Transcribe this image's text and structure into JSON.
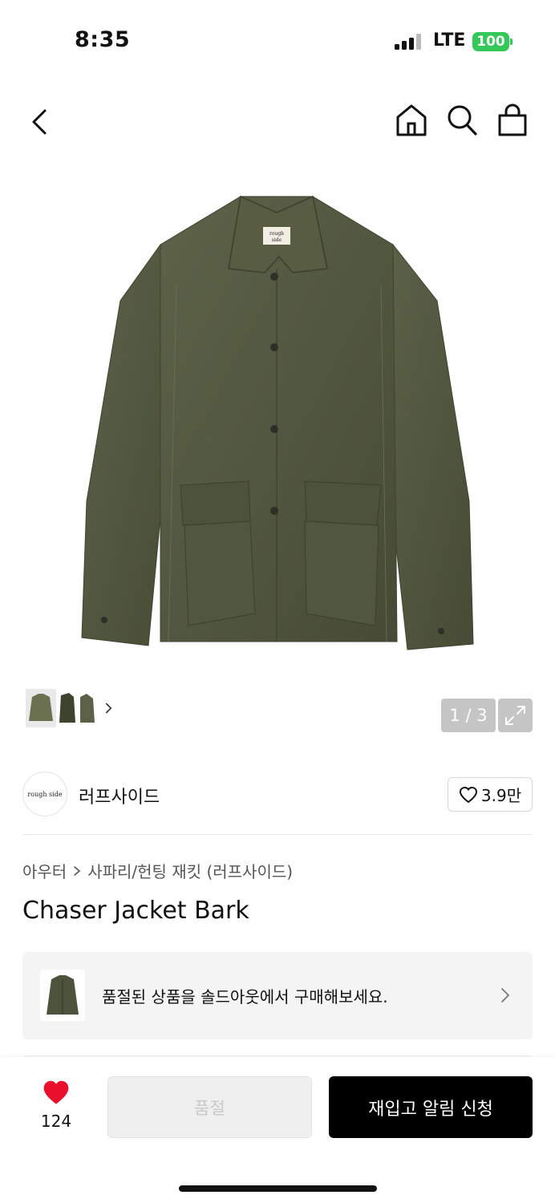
{
  "status_bar": {
    "time": "8:35",
    "network": "LTE",
    "battery": "100",
    "signal_bars_active": 3,
    "signal_bars_total": 4
  },
  "header": {
    "icons": [
      "back-arrow-icon",
      "home-icon",
      "search-icon",
      "shopping-bag-icon"
    ]
  },
  "gallery": {
    "page_indicator": "1 / 3",
    "current_page": 1,
    "total_pages": 3,
    "product_tag_text": "rough side"
  },
  "brand": {
    "logo_text": "rough side",
    "name": "러프사이드",
    "likes": "3.9만"
  },
  "breadcrumb": {
    "category": "아우터",
    "subcategory": "사파리/헌팅 재킷 (러프사이드)"
  },
  "product": {
    "title": "Chaser Jacket Bark"
  },
  "soldout_banner": {
    "text": "품절된 상품을 솔드아웃에서 구매해보세요."
  },
  "bottom_bar": {
    "favorite_count": "124",
    "soldout_label": "품절",
    "restock_label": "재입고 알림 신청"
  },
  "colors": {
    "accent_red": "#e8102b",
    "battery_green": "#34c759",
    "jacket_olive": "#555a40"
  }
}
